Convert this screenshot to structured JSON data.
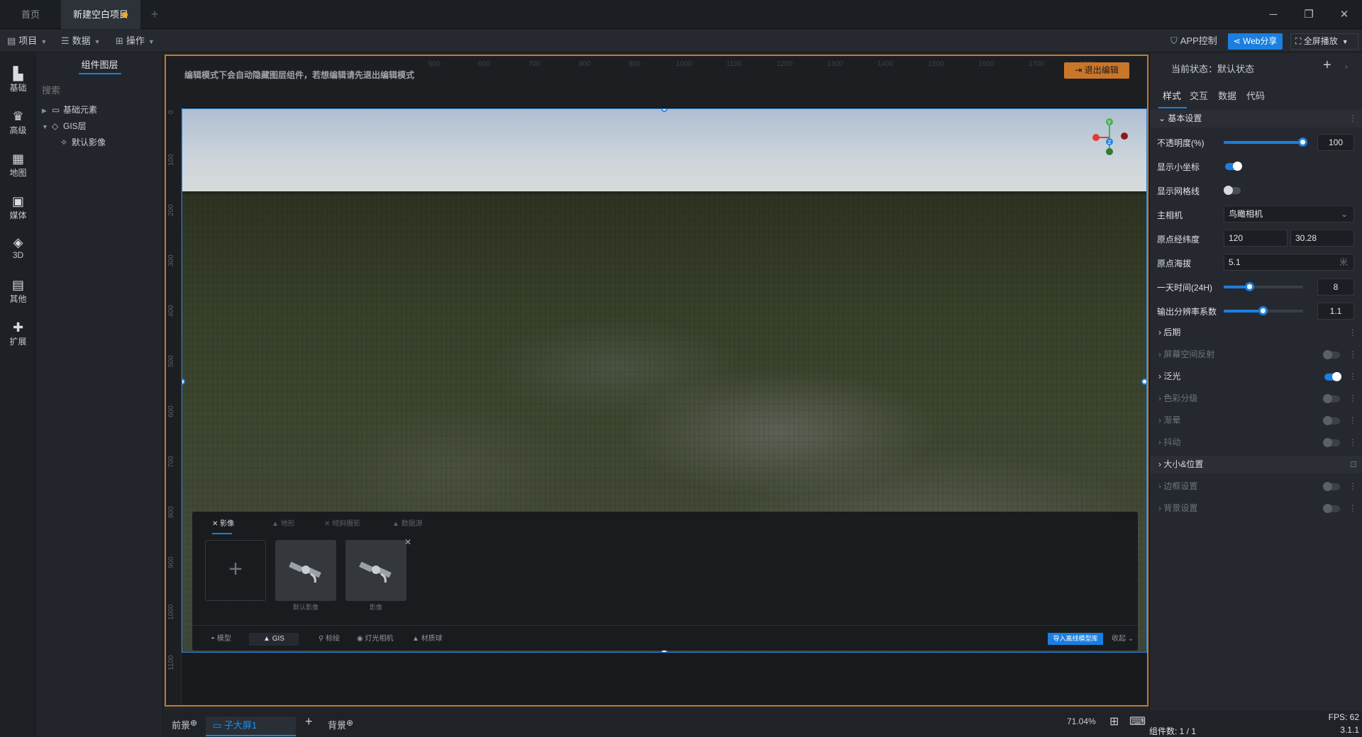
{
  "window": {
    "tabs": [
      "首页",
      "新建空白项目"
    ],
    "add_tab": "+",
    "controls": [
      "─",
      "❐",
      "✕"
    ]
  },
  "toolbar": {
    "menus": [
      "项目",
      "数据",
      "操作"
    ],
    "app_control": "APP控制",
    "web_share": "Web分享",
    "fullscreen": "全屏播放"
  },
  "rail": [
    "基础",
    "高级",
    "地图",
    "媒体",
    "3D",
    "其他",
    "扩展"
  ],
  "layers": {
    "title": "组件图层",
    "search_placeholder": "搜索",
    "tree": [
      "基础元素",
      "GIS层",
      "默认影像"
    ]
  },
  "canvas": {
    "banner": "编辑模式下会自动隐藏图层组件，若想编辑请先退出编辑模式",
    "exit_edit": "退出编辑",
    "ruler_top": [
      "500",
      "600",
      "700",
      "800",
      "900",
      "1000",
      "1100",
      "1200",
      "1300",
      "1400",
      "1500",
      "1600",
      "1700",
      "1800"
    ],
    "ruler_left": [
      "0",
      "100",
      "200",
      "300",
      "400",
      "500",
      "600",
      "700",
      "800",
      "900",
      "1000",
      "1100"
    ]
  },
  "gis_panel": {
    "tabs": [
      "影像",
      "地形",
      "倾斜摄影",
      "数据源"
    ],
    "cards": [
      "默认影像",
      "影像"
    ],
    "bottom": [
      "模型",
      "GIS",
      "标绘",
      "灯光相机",
      "材质球"
    ],
    "import_button": "导入离线模型库",
    "collapse": "收起"
  },
  "right_panel": {
    "state_label": "当前状态：默认状态",
    "tabs": [
      "样式",
      "交互",
      "数据",
      "代码"
    ],
    "sections": {
      "basic": "基本设置",
      "post": "后期",
      "ssr": "屏幕空间反射",
      "bloom": "泛光",
      "color": "色彩分级",
      "vignette": "渐晕",
      "shake": "抖动",
      "size": "大小&位置",
      "border": "边框设置",
      "background": "背景设置"
    },
    "props": {
      "opacity_label": "不透明度(%)",
      "opacity": "100",
      "opacity_fraction": 1.0,
      "mini_axis_label": "显示小坐标",
      "mini_axis_on": true,
      "grid_label": "显示网格线",
      "grid_on": false,
      "camera_label": "主相机",
      "camera_value": "鸟瞰相机",
      "origin_label": "原点经纬度",
      "origin_lng": "120",
      "origin_lat": "30.28",
      "altitude_label": "原点海拔",
      "altitude": "5.1",
      "altitude_unit": "米",
      "time_label": "一天时间(24H)",
      "time": "8",
      "time_fraction": 0.33,
      "res_label": "输出分辨率系数",
      "res": "1.1",
      "res_fraction": 0.5
    }
  },
  "status": {
    "foreground": "前景",
    "screen": "子大屏1",
    "background": "背景",
    "zoom": "71.04%",
    "fps": "FPS: 62",
    "component_count": "组件数: 1 / 1",
    "version": "3.1.1"
  },
  "colors": {
    "accent": "#1a7fe0",
    "canvas_border": "#c37a2a",
    "unsaved_dot": "#f0a830"
  }
}
